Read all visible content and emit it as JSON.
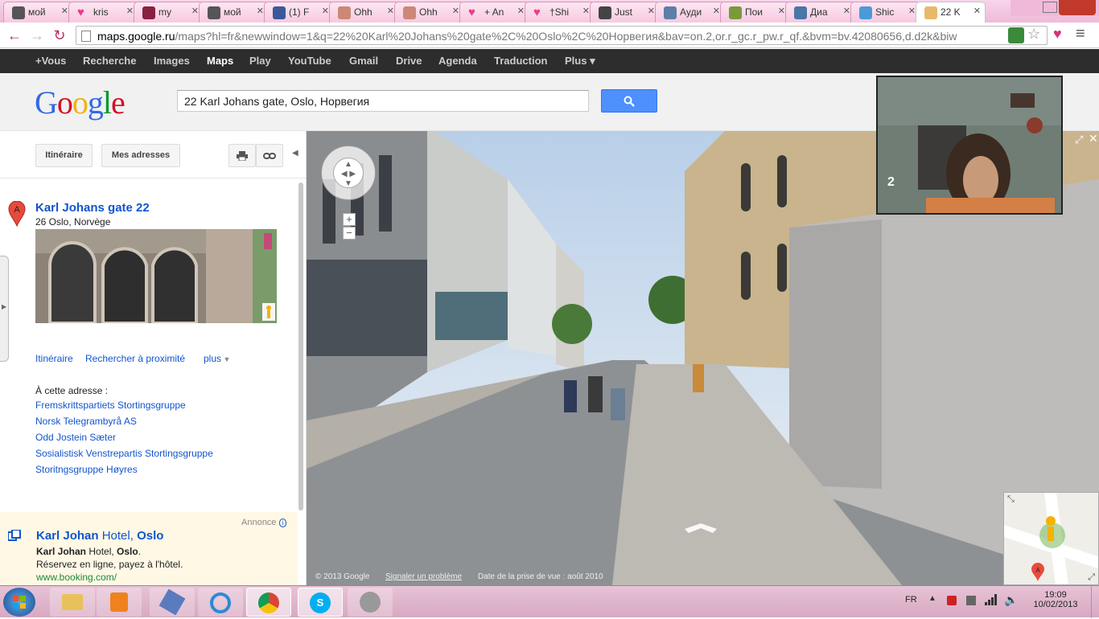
{
  "browser": {
    "tabs": [
      {
        "label": "мой",
        "fav": "#555"
      },
      {
        "label": "kris",
        "fav": "heart"
      },
      {
        "label": "my",
        "fav": "#8a2040"
      },
      {
        "label": "мой",
        "fav": "#555"
      },
      {
        "label": "(1) F",
        "fav": "#3b5998"
      },
      {
        "label": "Ohh",
        "fav": "#c87"
      },
      {
        "label": "Ohh",
        "fav": "#c87"
      },
      {
        "label": "+ An",
        "fav": "heart"
      },
      {
        "label": "†Shi",
        "fav": "heart"
      },
      {
        "label": "Just",
        "fav": "#444"
      },
      {
        "label": "Ауди",
        "fav": "#5b7fa6"
      },
      {
        "label": "Пои",
        "fav": "#7a9a3a"
      },
      {
        "label": "Диа",
        "fav": "#4a76a8"
      },
      {
        "label": "Shic",
        "fav": "#4a9ad8"
      },
      {
        "label": "22 K",
        "fav": "#e8b96a"
      }
    ],
    "url_host": "maps.google.ru",
    "url_rest": "/maps?hl=fr&newwindow=1&q=22%20Karl%20Johans%20gate%2C%20Oslo%2C%20Норвегия&bav=on.2,or.r_gc.r_pw.r_qf.&bvm=bv.42080656,d.d2k&biw"
  },
  "gbar": {
    "items": [
      "+Vous",
      "Recherche",
      "Images",
      "Maps",
      "Play",
      "YouTube",
      "Gmail",
      "Drive",
      "Agenda",
      "Traduction",
      "Plus ▾"
    ]
  },
  "search": {
    "logo": "Google",
    "query": "22 Karl Johans gate, Oslo, Норвегия"
  },
  "panel": {
    "itineraire_btn": "Itinéraire",
    "mes_adresses_btn": "Mes adresses",
    "result": {
      "marker": "A",
      "title": "Karl Johans gate 22",
      "address": "26 Oslo, Norvège"
    },
    "links": {
      "itineraire": "Itinéraire",
      "proximite": "Rechercher à proximité",
      "plus": "plus"
    },
    "at_address_label": "À cette adresse :",
    "at_address": [
      "Fremskrittspartiets Stortingsgruppe",
      "Norsk Telegrambyrå AS",
      "Odd Jostein Sæter",
      "Sosialistisk Venstrepartis Stortingsgruppe",
      "Storitngsgruppe Høyres"
    ],
    "ad": {
      "annonce": "Annonce",
      "title_bold1": "Karl Johan",
      "title_mid": " Hotel, ",
      "title_bold2": "Oslo",
      "line1_bold": "Karl Johan",
      "line1_rest": " Hotel, ",
      "line1_bold2": "Oslo",
      "line1_end": ".",
      "line2": "Réservez en ligne, payez à l'hôtel.",
      "url": "www.booking.com/"
    }
  },
  "streetview": {
    "copyright": "© 2013 Google",
    "report": "Signaler un problème",
    "date": "Date de la prise de vue : août 2010",
    "zoom_in": "+",
    "zoom_out": "−"
  },
  "webcam": {
    "label": "2"
  },
  "taskbar": {
    "lang": "FR",
    "time": "19:09",
    "date": "10/02/2013"
  }
}
